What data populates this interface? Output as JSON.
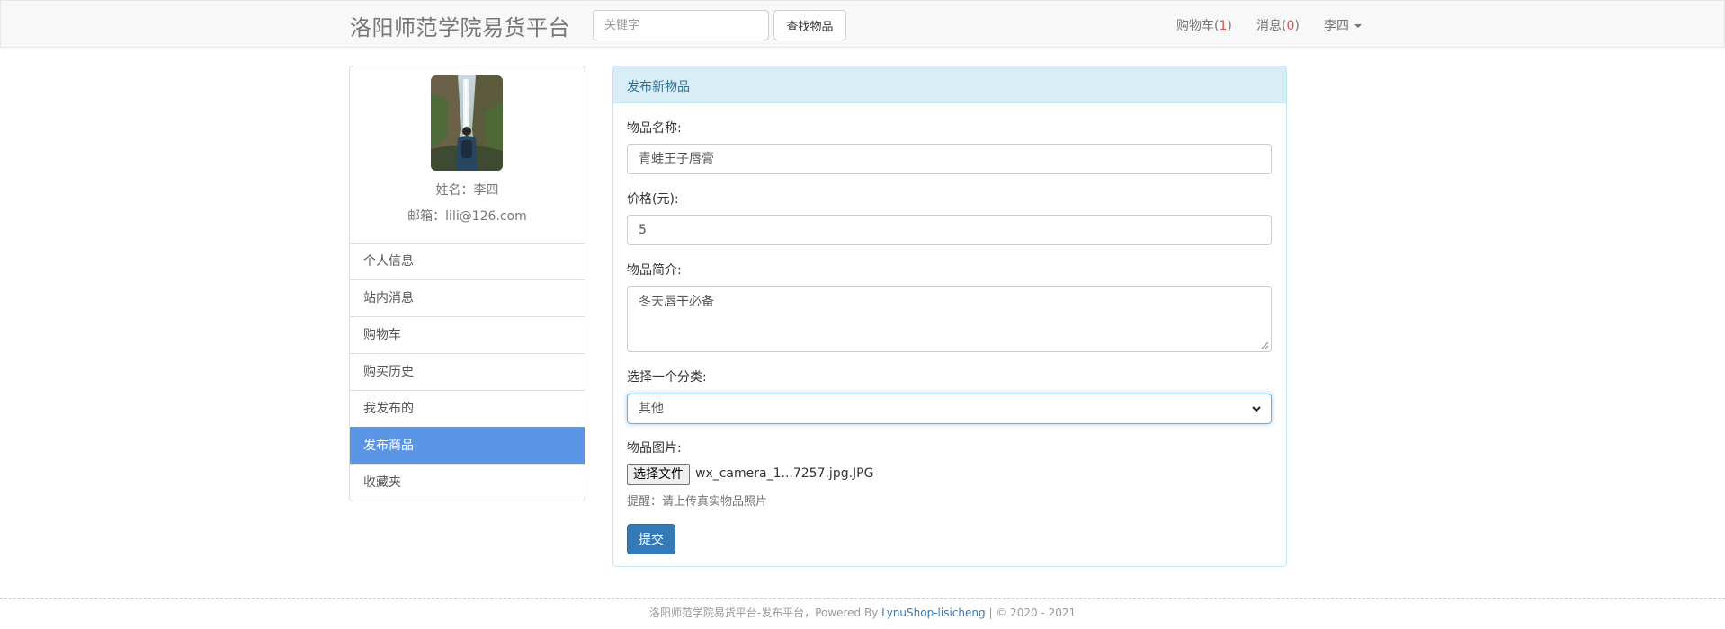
{
  "navbar": {
    "brand": "洛阳师范学院易货平台",
    "search_placeholder": "关键字",
    "search_button": "查找物品",
    "cart_label": "购物车(",
    "cart_count": "1",
    "cart_close": ")",
    "messages_label": "消息(",
    "messages_count": "0",
    "messages_close": ")",
    "user_name": "李四"
  },
  "profile": {
    "name_line": "姓名：李四",
    "email_line": "邮箱：lili@126.com"
  },
  "sidebar": {
    "items": [
      {
        "label": "个人信息"
      },
      {
        "label": "站内消息"
      },
      {
        "label": "购物车"
      },
      {
        "label": "购买历史"
      },
      {
        "label": "我发布的"
      },
      {
        "label": "发布商品"
      },
      {
        "label": "收藏夹"
      }
    ],
    "active_item": "发布商品"
  },
  "form": {
    "heading": "发布新物品",
    "name_label": "物品名称:",
    "name_value": "青蛙王子唇膏",
    "price_label": "价格(元):",
    "price_value": "5",
    "desc_label": "物品简介:",
    "desc_value": "冬天唇干必备",
    "category_label": "选择一个分类:",
    "category_value": "其他",
    "image_label": "物品图片:",
    "file_button": "选择文件",
    "file_name": "wx_camera_1...7257.jpg.JPG",
    "hint": "提醒：请上传真实物品照片",
    "submit": "提交"
  },
  "footer": {
    "text_prefix": "洛阳师范学院易货平台-发布平台，Powered By ",
    "link": "LynuShop-lisicheng",
    "text_suffix": " | © 2020 - 2021"
  },
  "colors": {
    "primary": "#337ab7",
    "active_menu": "#5a95e6",
    "panel_heading_bg": "#d9edf7",
    "badge_red": "#d9534f"
  }
}
